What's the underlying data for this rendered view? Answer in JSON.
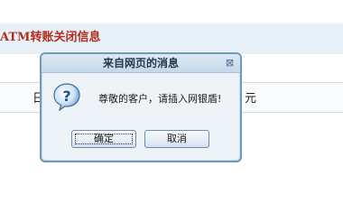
{
  "page": {
    "title": "ATM转账关闭信息",
    "row_left": "日",
    "row_right": "元"
  },
  "dialog": {
    "title": "来自网页的消息",
    "message": "尊敬的客户，请插入网银盾!",
    "ok_label": "确定",
    "cancel_label": "取消",
    "close_symbol": "⊠",
    "icon": "question-icon"
  },
  "colors": {
    "page_title": "#b22e1e",
    "dialog_border": "#6f9ab9",
    "titlebar": "#c4d8ea"
  }
}
